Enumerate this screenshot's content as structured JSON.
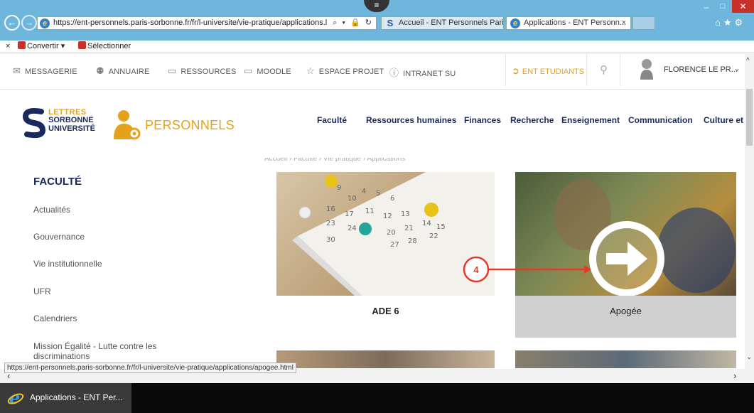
{
  "browser": {
    "address": "https://ent-personnels.paris-sorbonne.fr/fr/l-universite/vie-pratique/applications.l",
    "address_tools": "⌕ ▾ 🔒 ↻",
    "tabs": [
      {
        "label": "Accueil - ENT Personnels Paris ..."
      },
      {
        "label": "Applications - ENT Personn...",
        "close": "×"
      }
    ],
    "command_bar": {
      "close": "×",
      "convert": "Convertir",
      "convert_arrow": "▾",
      "select": "Sélectionner"
    },
    "status_url": "https://ent-personnels.paris-sorbonne.fr/fr/l-universite/vie-pratique/applications/apogee.html",
    "taskbar_label": "Applications - ENT Per..."
  },
  "topnav": {
    "items": [
      {
        "icon": "✉",
        "label": "MESSAGERIE"
      },
      {
        "icon": "⚉",
        "label": "ANNUAIRE"
      },
      {
        "icon": "▭",
        "label": "RESSOURCES"
      },
      {
        "icon": "▭",
        "label": "MOODLE"
      },
      {
        "icon": "☆",
        "label": "ESPACE PROJET"
      },
      {
        "icon": "ⓘ",
        "label": "INTRANET SU"
      }
    ],
    "ent_etudiants": "ENT ETUDIANTS",
    "user": "FLORENCE LE PR..."
  },
  "header": {
    "logo": {
      "lettres": "LETTRES",
      "sorbonne": "SORBONNE",
      "universite": "UNIVERSITÉ",
      "personnels": "PERSONNELS"
    },
    "nav": [
      "Faculté",
      "Ressources humaines",
      "Finances",
      "Recherche",
      "Enseignement",
      "Communication",
      "Culture et"
    ]
  },
  "sidebar": {
    "title": "FACULTÉ",
    "items": [
      "Actualités",
      "Gouvernance",
      "Vie institutionnelle",
      "UFR",
      "Calendriers",
      "Mission Égalité - Lutte contre les discriminations"
    ]
  },
  "breadcrumb": "Accueil  ›  Faculté  ›  Vie pratique  ›  Applications",
  "cards": [
    {
      "label": "ADE 6"
    },
    {
      "label": "Apogée"
    }
  ],
  "annotation": {
    "number": "4"
  },
  "colors": {
    "accent": "#e6a11c",
    "navy": "#1a2a5c",
    "annotation": "#e53a2a"
  }
}
